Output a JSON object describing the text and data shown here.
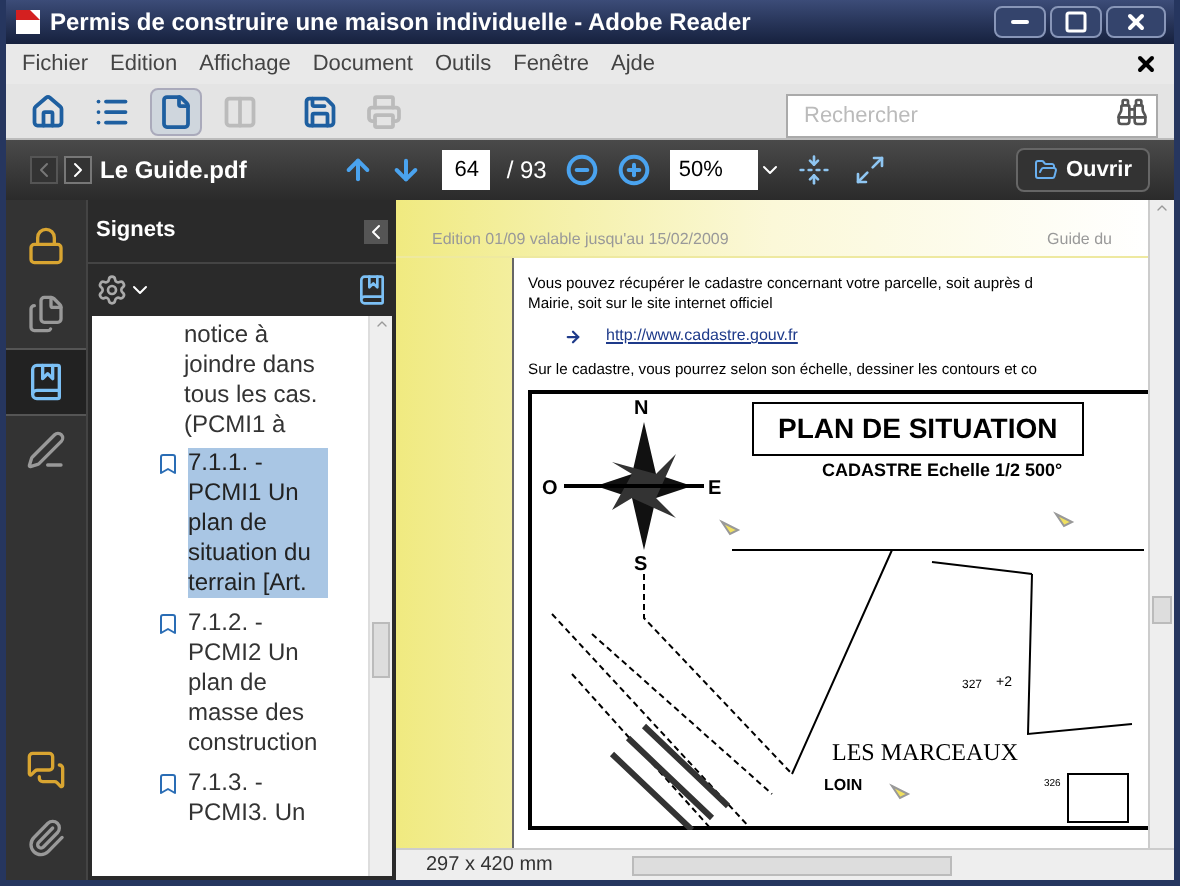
{
  "window": {
    "title": "Permis de construire une maison individuelle - Adobe Reader"
  },
  "menu": [
    "Fichier",
    "Edition",
    "Affichage",
    "Document",
    "Outils",
    "Fenêtre",
    "Ajde"
  ],
  "tools": [
    {
      "kind": "home",
      "selected": false,
      "disabled": false
    },
    {
      "kind": "list",
      "selected": false,
      "disabled": false
    },
    {
      "kind": "page",
      "selected": true,
      "disabled": false
    },
    {
      "kind": "spread",
      "selected": false,
      "disabled": true
    },
    {
      "kind": "save",
      "selected": false,
      "disabled": false
    },
    {
      "kind": "print",
      "selected": false,
      "disabled": true
    }
  ],
  "search": {
    "placeholder": "Rechercher"
  },
  "nav": {
    "filename": "Le Guide.pdf",
    "page": "64",
    "total": "/ 93",
    "zoom": "50%",
    "open_button": "Ouvrir"
  },
  "sidebar_tabs": [
    {
      "kind": "lock",
      "selected": false
    },
    {
      "kind": "pages",
      "selected": false
    },
    {
      "kind": "bookmarks",
      "selected": true
    },
    {
      "kind": "signature",
      "selected": false
    },
    {
      "kind": "comments",
      "selected": false
    },
    {
      "kind": "attachments",
      "selected": false
    }
  ],
  "bookmarks": {
    "title": "Signets",
    "items": [
      {
        "label": "notice à joindre dans tous les cas. (PCMI1 à",
        "selected": false,
        "children": [
          {
            "label": "7.1.1. - PCMI1 Un plan de situation du terrain [Art.",
            "selected": true
          },
          {
            "label": "7.1.2. - PCMI2 Un plan de masse des construction",
            "selected": false
          },
          {
            "label": "7.1.3. - PCMI3. Un",
            "selected": false
          }
        ]
      }
    ]
  },
  "document": {
    "header_left": "Edition 01/09 valable jusqu'au 15/02/2009",
    "header_right": "Guide du",
    "paragraph_1": [
      "Vous pouvez récupérer le cadastre concernant votre parcelle, soit auprès d",
      "Mairie, soit sur le site internet officiel"
    ],
    "link": "http://www.cadastre.gouv.fr",
    "paragraph_2": "Sur le cadastre, vous pourrez selon son échelle, dessiner les contours et co",
    "map": {
      "title": "PLAN DE SITUATION",
      "scale": "CADASTRE Echelle 1/2 500°",
      "north": "N",
      "west": "O",
      "east": "E",
      "south": "S",
      "parcel_a": "327",
      "mark": "+2",
      "place": "LES MARCEAUX",
      "place_2": "LOIN",
      "parcel_b": "326"
    }
  },
  "status": {
    "page_size": "297 x 420 mm"
  }
}
